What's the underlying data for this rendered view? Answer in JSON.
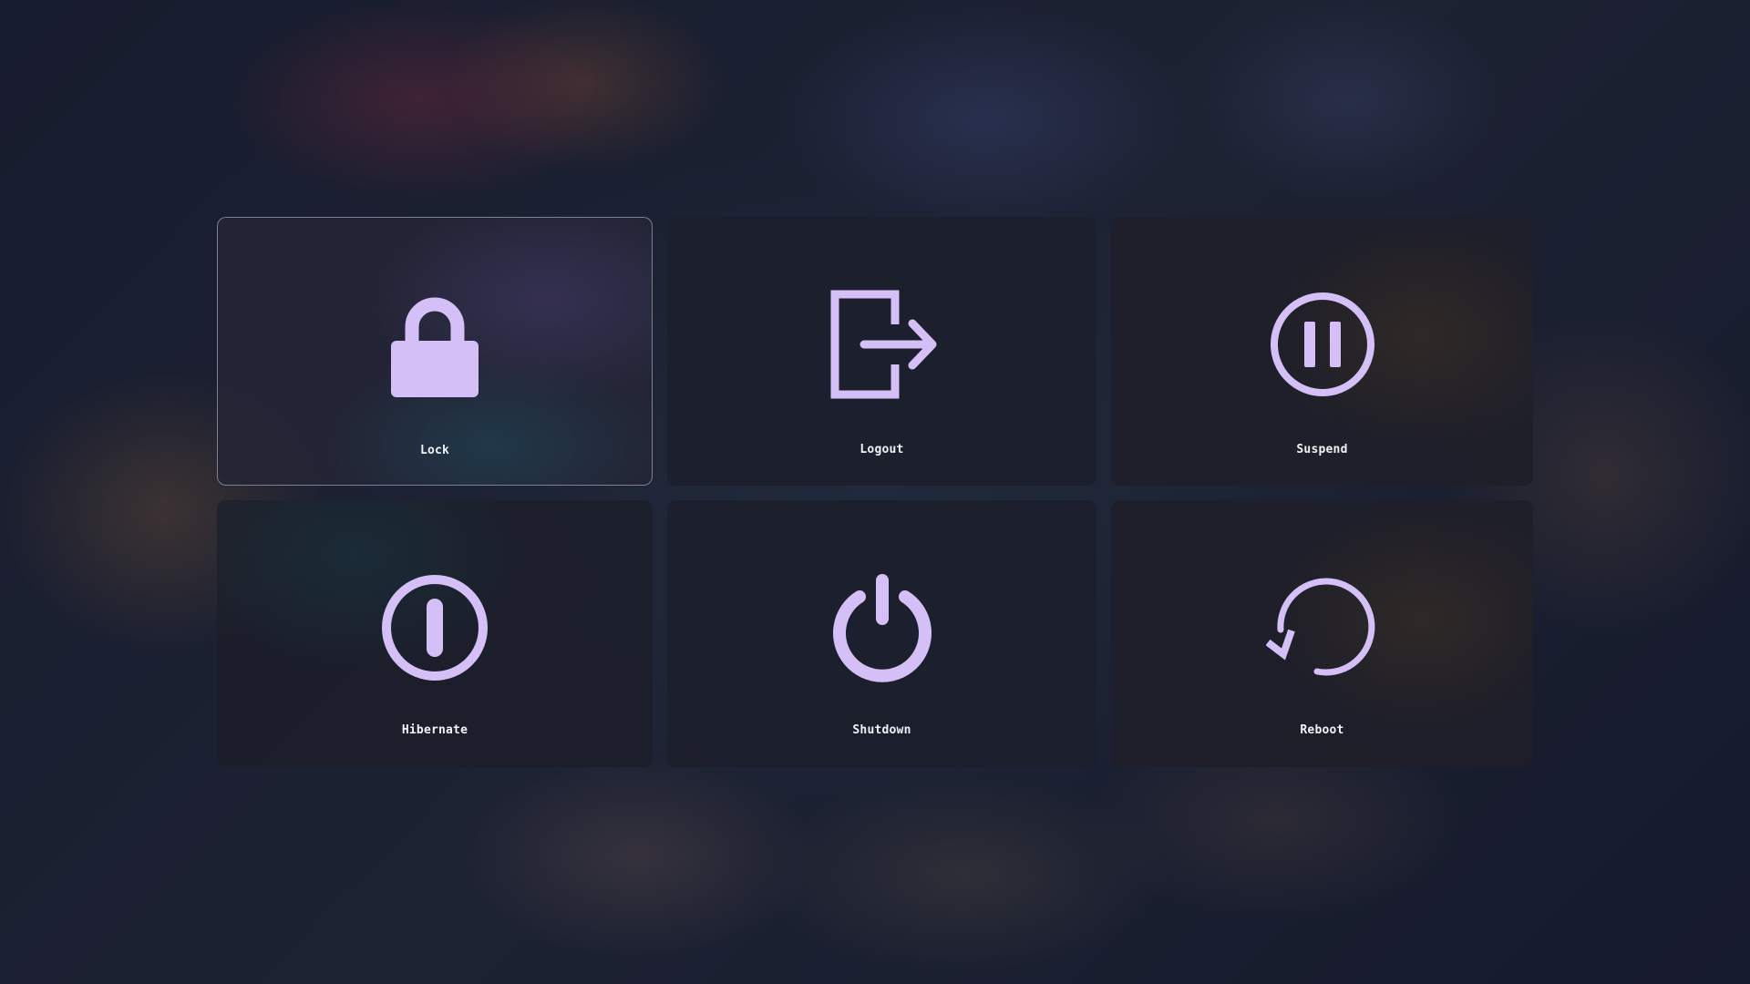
{
  "accent_color": "#d4bff7",
  "selected_item": "Lock",
  "menu": {
    "items": [
      {
        "label": "Lock",
        "icon": "lock-icon"
      },
      {
        "label": "Logout",
        "icon": "logout-icon"
      },
      {
        "label": "Suspend",
        "icon": "pause-icon"
      },
      {
        "label": "Hibernate",
        "icon": "hibernate-icon"
      },
      {
        "label": "Shutdown",
        "icon": "power-icon"
      },
      {
        "label": "Reboot",
        "icon": "reboot-icon"
      }
    ]
  }
}
